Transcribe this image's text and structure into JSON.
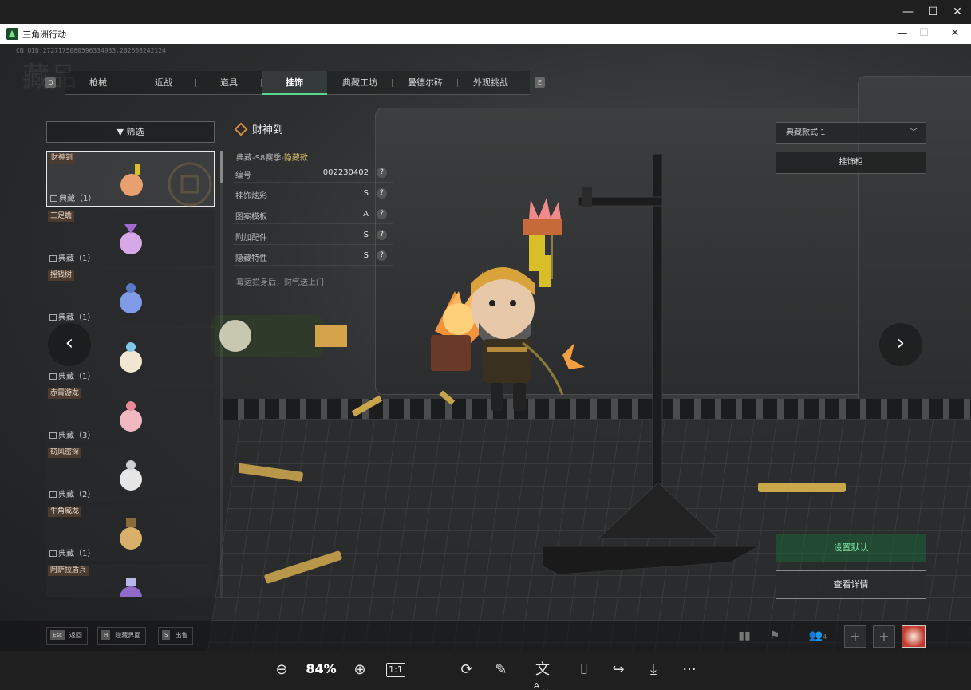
{
  "game_window": {
    "title": "三角洲行动",
    "uid": "CN UID:2727175060596334933,202608242124",
    "watermark": "藏品"
  },
  "tabs": [
    {
      "label": "枪械",
      "active": false
    },
    {
      "label": "近战",
      "active": false
    },
    {
      "label": "道具",
      "active": false
    },
    {
      "label": "挂饰",
      "active": true
    },
    {
      "label": "典藏工坊",
      "active": false
    },
    {
      "label": "曼德尔砖",
      "active": false
    },
    {
      "label": "外观挑战",
      "active": false
    }
  ],
  "tab_keys": {
    "left": "Q",
    "right": "E"
  },
  "filter": {
    "label": "筛选"
  },
  "items": [
    {
      "name": "财神到",
      "grade": "典藏（1）",
      "selected": true,
      "color": "#e8a070"
    },
    {
      "name": "三足蟾",
      "grade": "典藏（1）",
      "selected": false,
      "color": "#d6a8e8"
    },
    {
      "name": "摇钱树",
      "grade": "典藏（1）",
      "selected": false,
      "color": "#7f9be8"
    },
    {
      "name": "",
      "grade": "典藏（1）",
      "selected": false,
      "color": "#f0e6d2"
    },
    {
      "name": "赤霄游龙",
      "grade": "典藏（3）",
      "selected": false,
      "color": "#f0b8c0"
    },
    {
      "name": "窃风密探",
      "grade": "典藏（2）",
      "selected": false,
      "color": "#e6e6e6"
    },
    {
      "name": "牛角威龙",
      "grade": "典藏（1）",
      "selected": false,
      "color": "#d9b06a"
    },
    {
      "name": "阿萨拉盾兵",
      "grade": "",
      "selected": false,
      "color": "#8e6ac9"
    }
  ],
  "detail": {
    "title": "财神到",
    "subtitle_prefix": "典藏-S8赛季-",
    "subtitle_highlight": "隐藏款",
    "attributes": [
      {
        "key": "编号",
        "value": "002230402"
      },
      {
        "key": "挂饰炫彩",
        "value": "S"
      },
      {
        "key": "图案模板",
        "value": "A"
      },
      {
        "key": "附加配件",
        "value": "S"
      },
      {
        "key": "隐藏特性",
        "value": "S"
      }
    ],
    "description": "霉运拦身后，财气送上门"
  },
  "right_panel": {
    "style_select": "典藏款式 1",
    "cabinet_button": "挂饰柜",
    "default_button": "设置默认",
    "detail_button": "查看详情"
  },
  "bottom_hints": [
    {
      "key": "Esc",
      "label": "返回"
    },
    {
      "key": "H",
      "label": "隐藏界面"
    },
    {
      "key": "S",
      "label": "出售"
    }
  ],
  "bottom_icons": {
    "friends_count": "4"
  },
  "viewer": {
    "zoom": "84%",
    "actual_size": "1:1"
  },
  "colors": {
    "accent_green": "#3fd37f",
    "selected_border": "#e8e8e8",
    "name_tag": "#4a3a30",
    "highlight_gold": "#e2c36a"
  }
}
